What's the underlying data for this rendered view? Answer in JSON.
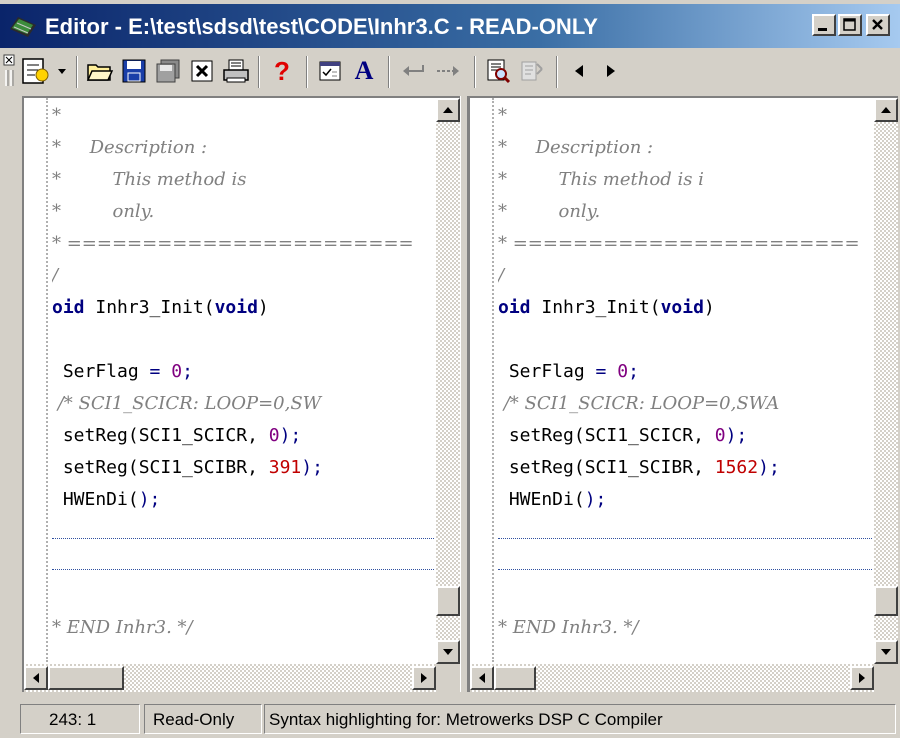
{
  "window": {
    "title": "Editor - E:\\test\\sdsd\\test\\CODE\\Inhr3.C - READ-ONLY",
    "controls": [
      "minimize-icon",
      "maximize-icon",
      "close-icon"
    ]
  },
  "toolbar": {
    "items": [
      "templates-icon",
      "dropdown-arrow-icon",
      "open-folder-icon",
      "save-icon",
      "save-all-icon",
      "close-file-icon",
      "print-icon",
      "help-icon",
      "properties-icon",
      "font-icon",
      "undo-icon",
      "redo-icon",
      "find-icon",
      "replace-icon",
      "previous-icon",
      "next-icon"
    ],
    "help_label": "?",
    "font_label": "A"
  },
  "left_pane": {
    "lines": {
      "l1": "*",
      "l2": "*     Description :",
      "l3": "*         This method is",
      "l4": "*         only.",
      "l5": "* =======================",
      "l6": "/",
      "l7_a": "oid",
      "l7_b": " Inhr3_Init(",
      "l7_c": "void",
      "l7_d": ")",
      "l8_a": " SerFlag ",
      "l8_b": "=",
      "l8_c": " ",
      "l8_d": "0",
      "l8_e": ";",
      "l9": " /* SCI1_SCICR: LOOP=0,SW",
      "l10_a": " setReg(SCI1_SCICR, ",
      "l10_b": "0",
      "l10_c": ");",
      "l11_a": " setReg(SCI1_SCIBR, ",
      "l11_b": "391",
      "l11_c": ");",
      "l12_a": " HWEnDi(",
      "l12_b": ");",
      "l13": "* END Inhr3. */"
    }
  },
  "right_pane": {
    "lines": {
      "l1": "*",
      "l2": "*     Description :",
      "l3": "*         This method is i",
      "l4": "*         only.",
      "l5": "* =======================",
      "l6": "/",
      "l7_a": "oid",
      "l7_b": " Inhr3_Init(",
      "l7_c": "void",
      "l7_d": ")",
      "l8_a": " SerFlag ",
      "l8_b": "=",
      "l8_c": " ",
      "l8_d": "0",
      "l8_e": ";",
      "l9": " /* SCI1_SCICR: LOOP=0,SWA",
      "l10_a": " setReg(SCI1_SCICR, ",
      "l10_b": "0",
      "l10_c": ");",
      "l11_a": " setReg(SCI1_SCIBR, ",
      "l11_b": "1562",
      "l11_c": ");",
      "l12_a": " HWEnDi(",
      "l12_b": ");",
      "l13": "* END Inhr3. */"
    }
  },
  "statusbar": {
    "position": "243: 1",
    "mode": "Read-Only",
    "syntax": "Syntax highlighting for: Metrowerks DSP C Compiler"
  },
  "colors": {
    "title_start": "#0a246a",
    "title_end": "#a6caf0",
    "comment": "#808080",
    "keyword": "#000080",
    "number": "#800080",
    "changed_number": "#c00000",
    "chrome": "#d4d0c8"
  }
}
